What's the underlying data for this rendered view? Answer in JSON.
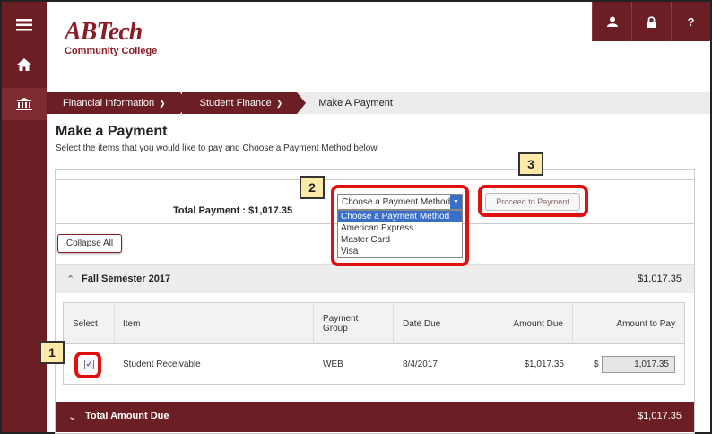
{
  "sidebar": {
    "menu_icon": "hamburger-menu-icon",
    "home_icon": "home-icon",
    "finance_icon": "bank-icon"
  },
  "header": {
    "logo_main": "ABTech",
    "logo_sub": "Community College",
    "icons": [
      "user-icon",
      "lock-icon",
      "help-icon"
    ],
    "help_glyph": "?"
  },
  "breadcrumb": {
    "items": [
      {
        "label": "Financial Information"
      },
      {
        "label": "Student Finance"
      }
    ],
    "current": "Make A Payment"
  },
  "page": {
    "title": "Make a Payment",
    "subtitle": "Select the items that you would like to pay and Choose a Payment Method below"
  },
  "payment": {
    "total_label": "Total Payment : $1,017.35",
    "method_select": {
      "value": "Choose a Payment Method",
      "options": [
        "Choose a Payment Method",
        "American Express",
        "Master Card",
        "Visa"
      ]
    },
    "proceed_label": "Proceed to Payment",
    "collapse_label": "Collapse All"
  },
  "semester": {
    "title": "Fall Semester 2017",
    "amount": "$1,017.35"
  },
  "table": {
    "headers": [
      "Select",
      "Item",
      "Payment Group",
      "Date Due",
      "Amount Due",
      "Amount to Pay"
    ],
    "rows": [
      {
        "checked": true,
        "item": "Student Receivable",
        "group": "WEB",
        "date_due": "8/4/2017",
        "amount_due": "$1,017.35",
        "currency": "$",
        "amount_to_pay": "1,017.35"
      }
    ]
  },
  "total_due": {
    "title": "Total Amount Due",
    "amount": "$1,017.35"
  },
  "callouts": [
    "1",
    "2",
    "3"
  ],
  "colors": {
    "brand": "#6b1e24",
    "highlight": "#e01010",
    "callout_bg": "#fde9a8",
    "select_blue": "#3a6fc7"
  }
}
